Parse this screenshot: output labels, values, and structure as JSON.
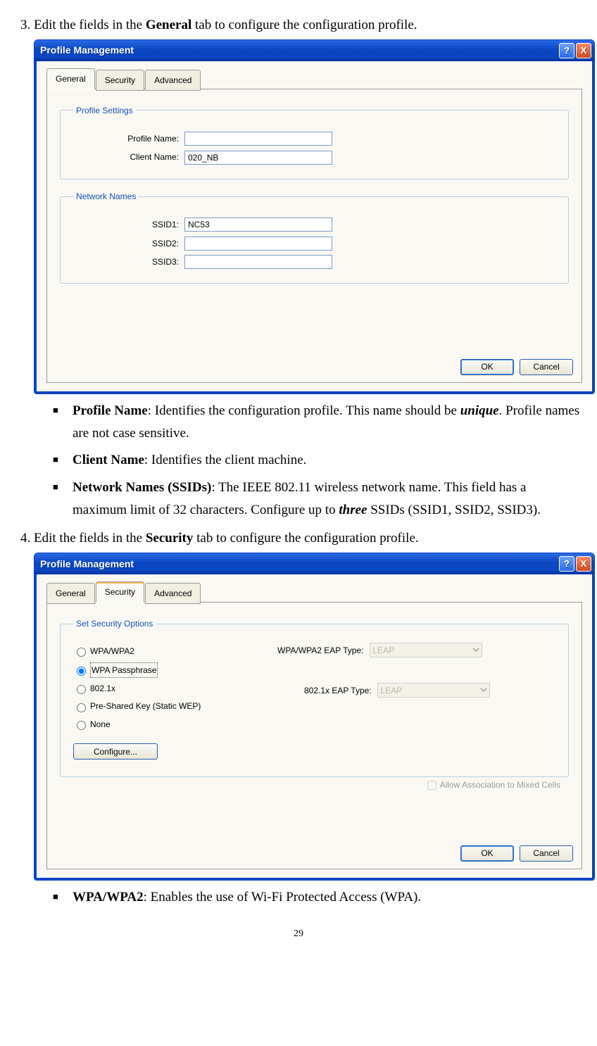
{
  "step3": {
    "num": "3.",
    "before": "Edit the fields in the ",
    "bold": "General",
    "after": " tab to configure the configuration profile."
  },
  "dialog1": {
    "title": "Profile Management",
    "tabs": {
      "general": "General",
      "security": "Security",
      "advanced": "Advanced"
    },
    "group1": {
      "legend": "Profile Settings",
      "profile_name_lbl": "Profile Name:",
      "profile_name_val": "",
      "client_name_lbl": "Client Name:",
      "client_name_val": "020_NB"
    },
    "group2": {
      "legend": "Network Names",
      "ssid1_lbl": "SSID1:",
      "ssid1_val": "NC53",
      "ssid2_lbl": "SSID2:",
      "ssid2_val": "",
      "ssid3_lbl": "SSID3:",
      "ssid3_val": ""
    },
    "ok": "OK",
    "cancel": "Cancel",
    "help": "?",
    "close": "X"
  },
  "bullets1": {
    "pn_head": "Profile Name",
    "pn_body1": ": Identifies the configuration profile. This name should be ",
    "pn_italic": "unique",
    "pn_body2": ". Profile names are not case sensitive.",
    "cn_head": "Client Name",
    "cn_body": ": Identifies the client machine.",
    "nn_head": "Network Names (SSIDs)",
    "nn_body1": ": The IEEE 802.11 wireless network name. This field has a maximum limit of 32 characters. Configure up to ",
    "nn_italic": "three",
    "nn_body2": " SSIDs (SSID1, SSID2, SSID3)."
  },
  "step4": {
    "num": "4.",
    "before": "Edit the fields in the ",
    "bold": "Security",
    "after": " tab to configure the configuration profile."
  },
  "dialog2": {
    "title": "Profile Management",
    "tabs": {
      "general": "General",
      "security": "Security",
      "advanced": "Advanced"
    },
    "group": {
      "legend": "Set Security Options",
      "wpa": "WPA/WPA2",
      "eap1_lbl": "WPA/WPA2 EAP Type:",
      "eap1_val": "LEAP",
      "passphrase": "WPA Passphrase",
      "x8021": "802.1x",
      "eap2_lbl": "802.1x EAP Type:",
      "eap2_val": "LEAP",
      "psk": "Pre-Shared Key (Static WEP)",
      "none": "None",
      "configure": "Configure...",
      "mixed": "Allow Association to Mixed Cells"
    },
    "ok": "OK",
    "cancel": "Cancel",
    "help": "?",
    "close": "X"
  },
  "bullets2": {
    "wpa_head": "WPA/WPA2",
    "wpa_body": ": Enables the use of Wi-Fi Protected Access (WPA)."
  },
  "page": "29"
}
